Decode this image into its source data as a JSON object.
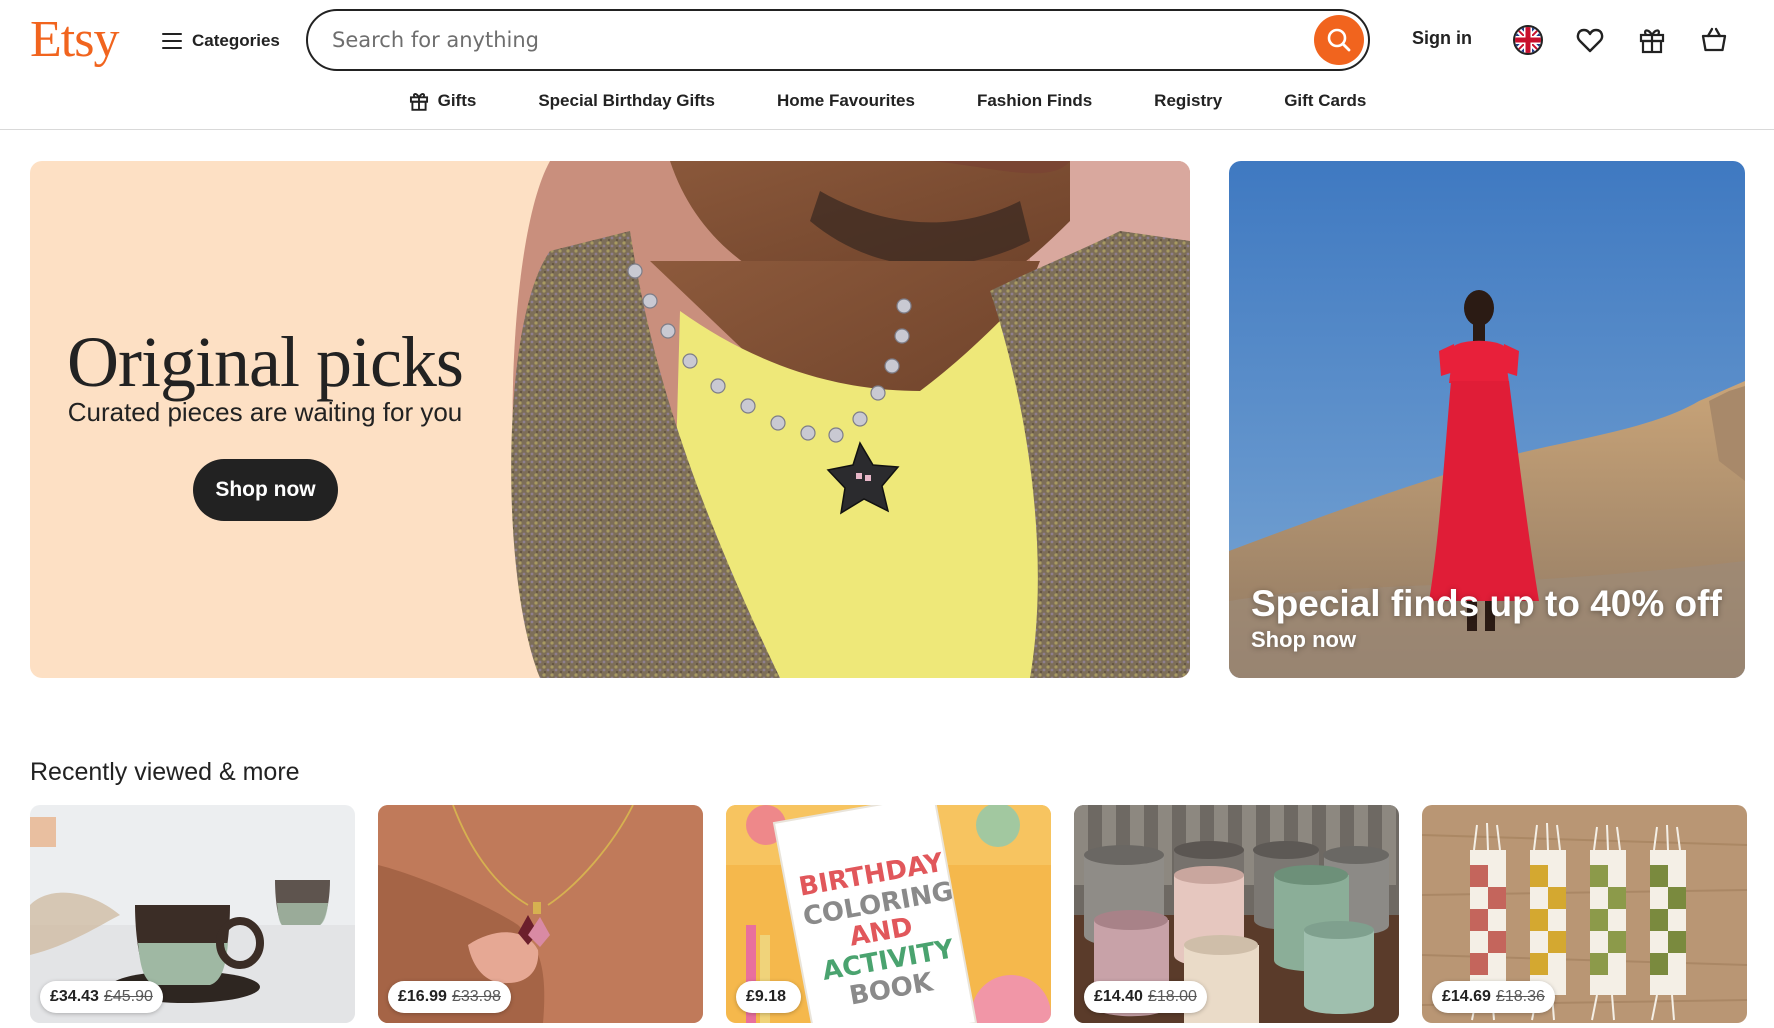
{
  "header": {
    "logo": "Etsy",
    "categories_label": "Categories",
    "search_placeholder": "Search for anything",
    "search_value": "",
    "sign_in_label": "Sign in",
    "icons": [
      "search-icon",
      "uk-flag-icon",
      "heart-icon",
      "gift-icon",
      "basket-icon"
    ]
  },
  "nav": {
    "items": [
      {
        "label": "Gifts",
        "icon": "gift-icon"
      },
      {
        "label": "Special Birthday Gifts"
      },
      {
        "label": "Home Favourites"
      },
      {
        "label": "Fashion Finds"
      },
      {
        "label": "Registry"
      },
      {
        "label": "Gift Cards"
      }
    ]
  },
  "hero": {
    "title": "Original picks",
    "subtitle": "Curated pieces are waiting for you",
    "button_label": "Shop now"
  },
  "promo": {
    "title": "Special finds up to 40% off",
    "link_label": "Shop now"
  },
  "recent": {
    "title": "Recently viewed & more",
    "items": [
      {
        "price": "£34.43",
        "original_price": "£45.90"
      },
      {
        "price": "£16.99",
        "original_price": "£33.98"
      },
      {
        "price": "£9.18",
        "original_price": ""
      },
      {
        "price": "£14.40",
        "original_price": "£18.00"
      },
      {
        "price": "£14.69",
        "original_price": "£18.36"
      }
    ],
    "book_cover_text": [
      "BIRTHDAY",
      "COLORING",
      "AND",
      "ACTIVITY",
      "BOOK"
    ]
  },
  "colors": {
    "brand_orange": "#f1641e",
    "hero_peach": "#fde0c4",
    "dark": "#222222",
    "sky_blue": "#4d86c6"
  }
}
